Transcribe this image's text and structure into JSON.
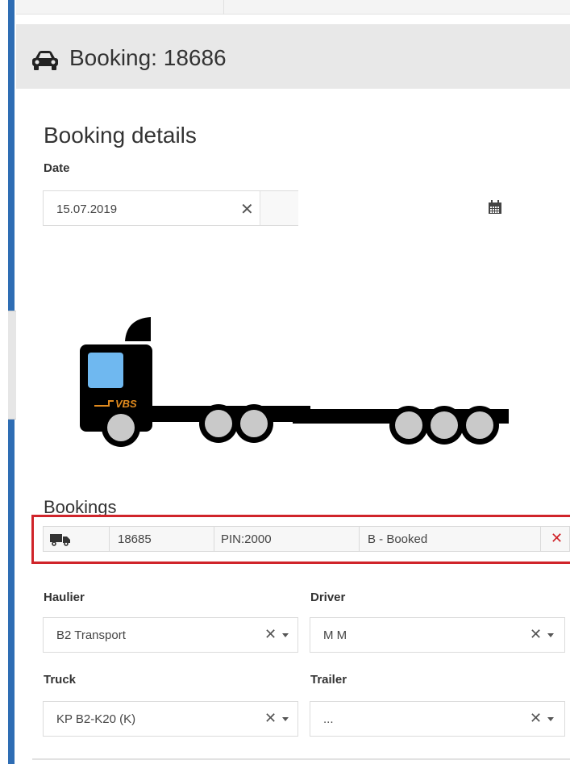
{
  "header": {
    "title": "Booking: 18686",
    "icon": "car-icon"
  },
  "details": {
    "title": "Booking details",
    "date_label": "Date",
    "date_value": "15.07.2019"
  },
  "truck_image": {
    "logo_text": "VBS"
  },
  "bookings": {
    "title": "Bookings",
    "rows": [
      {
        "icon": "truck-icon",
        "id": "18685",
        "pin": "PIN:2000",
        "status": "B - Booked"
      }
    ]
  },
  "fields": {
    "haulier_label": "Haulier",
    "haulier_value": "B2 Transport",
    "driver_label": "Driver",
    "driver_value": "M M",
    "truck_label": "Truck",
    "truck_value": "KP B2-K20 (K)",
    "trailer_label": "Trailer",
    "trailer_value": "..."
  },
  "colors": {
    "accent": "#2e6db4",
    "highlight": "#d0242a",
    "header_bg": "#e8e8e8"
  }
}
